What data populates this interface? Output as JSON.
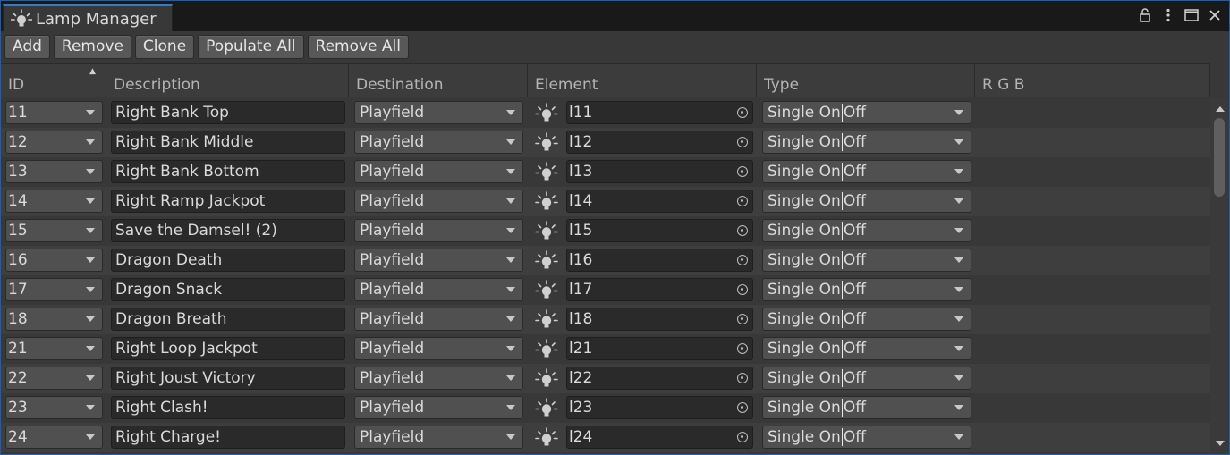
{
  "window": {
    "tab_title": "Lamp Manager",
    "tab_icon": "lamp-icon",
    "controls": [
      "lock-icon",
      "kebab-menu-icon",
      "maximize-icon",
      "close-icon"
    ]
  },
  "toolbar": {
    "add": "Add",
    "remove": "Remove",
    "clone": "Clone",
    "populate_all": "Populate All",
    "remove_all": "Remove All"
  },
  "table": {
    "headers": {
      "id": "ID",
      "description": "Description",
      "destination": "Destination",
      "element": "Element",
      "type": "Type",
      "rgb": "R G B"
    },
    "sort_indicator": "▲",
    "type_on": "Single On",
    "type_off": "Off",
    "rows": [
      {
        "id": "11",
        "description": "Right Bank Top",
        "destination": "Playfield",
        "element": "l11"
      },
      {
        "id": "12",
        "description": "Right Bank Middle",
        "destination": "Playfield",
        "element": "l12"
      },
      {
        "id": "13",
        "description": "Right Bank Bottom",
        "destination": "Playfield",
        "element": "l13"
      },
      {
        "id": "14",
        "description": "Right Ramp Jackpot",
        "destination": "Playfield",
        "element": "l14"
      },
      {
        "id": "15",
        "description": "Save the Damsel! (2)",
        "destination": "Playfield",
        "element": "l15"
      },
      {
        "id": "16",
        "description": "Dragon Death",
        "destination": "Playfield",
        "element": "l16"
      },
      {
        "id": "17",
        "description": "Dragon Snack",
        "destination": "Playfield",
        "element": "l17"
      },
      {
        "id": "18",
        "description": "Dragon Breath",
        "destination": "Playfield",
        "element": "l18"
      },
      {
        "id": "21",
        "description": "Right Loop Jackpot",
        "destination": "Playfield",
        "element": "l21"
      },
      {
        "id": "22",
        "description": "Right Joust Victory",
        "destination": "Playfield",
        "element": "l22"
      },
      {
        "id": "23",
        "description": "Right Clash!",
        "destination": "Playfield",
        "element": "l23"
      },
      {
        "id": "24",
        "description": "Right Charge!",
        "destination": "Playfield",
        "element": "l24"
      }
    ]
  },
  "colors": {
    "accent": "#3a79bb",
    "panel": "#383838",
    "field": "#2a2a2a",
    "dropdown": "#505050"
  }
}
